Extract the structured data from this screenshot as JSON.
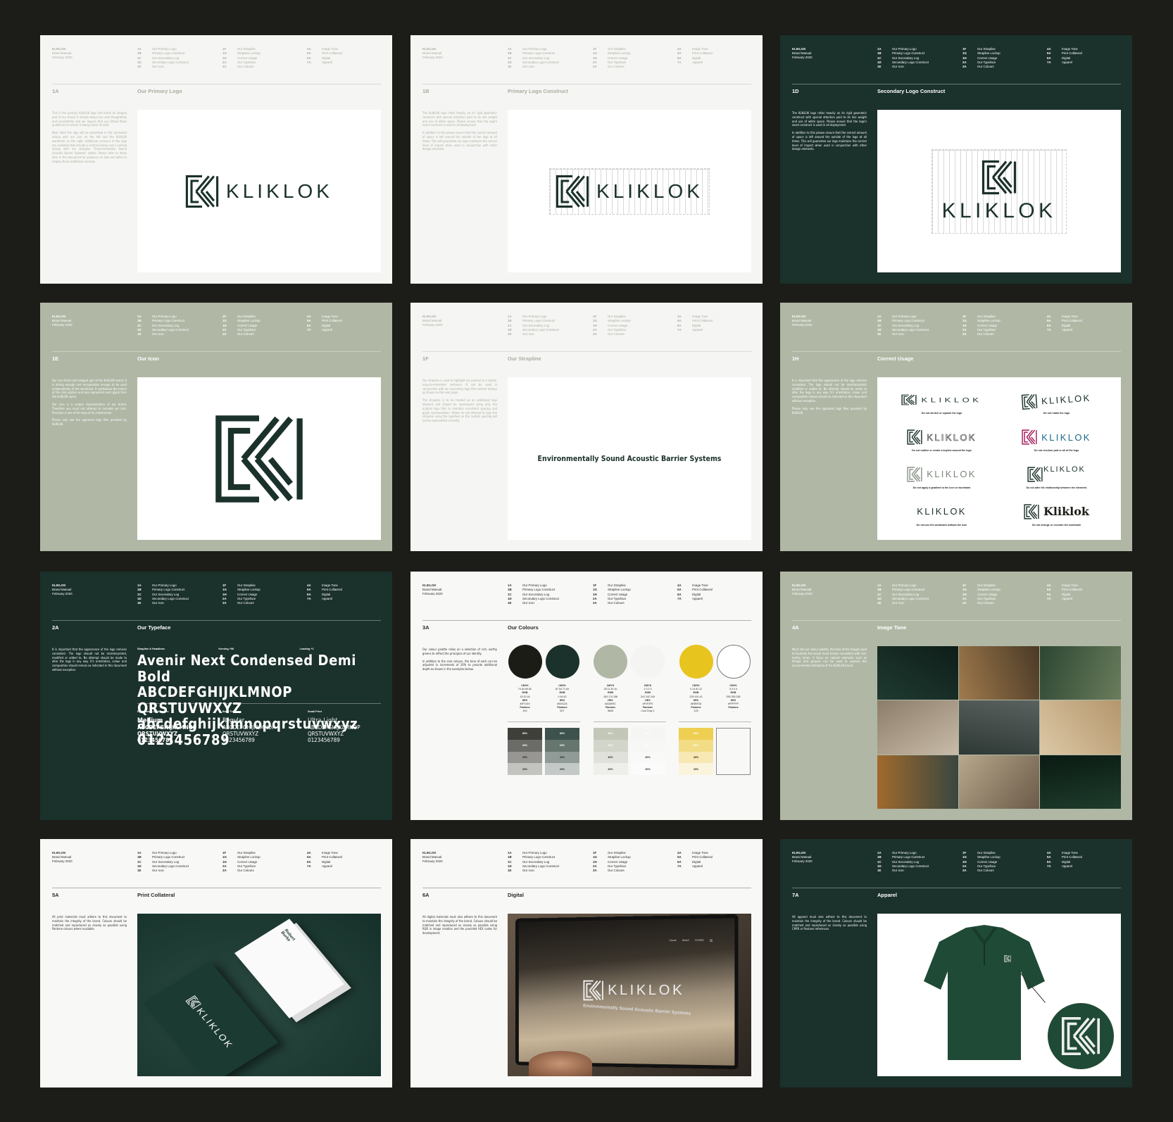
{
  "brand_block": {
    "name": "KLIKLOK",
    "line1": "Brand Manual",
    "line2": "February 2020"
  },
  "nav": [
    [
      [
        "1A",
        "Our Primary Logo"
      ],
      [
        "1B",
        "Primary Logo Construct"
      ],
      [
        "1C",
        "Our Secondary Log"
      ],
      [
        "1D",
        "Secondary Logo Construct"
      ],
      [
        "1E",
        "Our Icon"
      ]
    ],
    [
      [
        "1F",
        "Our Strapline"
      ],
      [
        "1G",
        "Strapline Lockup"
      ],
      [
        "1H",
        "Correct Usage"
      ],
      [
        "2A",
        "Our Typeface"
      ],
      [
        "3A",
        "Our Colours"
      ]
    ],
    [
      [
        "4A",
        "Image Tone"
      ],
      [
        "5A",
        "Print Collateral"
      ],
      [
        "6A",
        "Digital"
      ],
      [
        "7A",
        "Apparel"
      ]
    ]
  ],
  "colors": {
    "dark_green": "#1b312b",
    "sage": "#b0b8a5",
    "off_white": "#f5f5f3",
    "background": "#1c1d18"
  },
  "logo": {
    "wordmark": "KLIKLOK",
    "strapline": "Environmentally Sound Acoustic Barrier Systems"
  },
  "pages": [
    {
      "id": "1A",
      "title": "Our Primary Logo",
      "theme": "light",
      "content": "primary-logo",
      "body": [
        "This is the primary KLIKLOK logo and forms an integral part of our brand. It should always be used thoughtfully and consistently and we require that you follow these guidelines to ensure it always looks its best.",
        "Most often the logo will be presented in this horizontal lockup with our icon on the left and the KLIKLOK wordmark on the right. Additional versions of the logo are available that include a vertical lockup and a vertical lockup with our strapline \"Environmentally Sound Acoustic Barrier Systems\" added. Please refer to items later in this document for guidance on how and when to employ these additional versions."
      ]
    },
    {
      "id": "1B",
      "title": "Primary Logo Construct",
      "theme": "light",
      "content": "logo-construct",
      "body": [
        "The KLIKLOK logo relies heavily on its rigid geometric construct with special attention paid to its line weight and use of white space. Please ensure that the logo's exact construct is used in all deployment.",
        "In addition to this please ensure that the correct amount of space is left around the outside of the logo at all times. This will guarantee our logo maintains the correct level of impact when used in conjunction with other design elements."
      ]
    },
    {
      "id": "1D",
      "title": "Secondary Logo Construct",
      "theme": "dark",
      "content": "secondary-construct",
      "body": [
        "The KLIKLOK logo relies heavily on its rigid geometric construct with special attention paid to its line weight and use of white space. Please ensure that the logo's exact construct is used in all deployment.",
        "In addition to this please ensure that the correct amount of space is left around the outside of the logo at all times. This will guarantee our logo maintains the correct level of impact when used in conjunction with other design elements."
      ]
    },
    {
      "id": "1E",
      "title": "Our Icon",
      "theme": "sage",
      "content": "icon",
      "body": [
        "Our icon forms and integral part of the KLIKLOK brand. It is strong enough and recognisable enough to be used independently of the wordmark. It symbolises the nature of the click system and also represents each glyph from the KLIKLOK name.",
        "Our icon is a unique representation of our brand. Therefore you must not attempt to recreate our icon. Precision is one of the keys of its construction.",
        "Please only use the approved logo files provided by KLIKLOK."
      ]
    },
    {
      "id": "1F",
      "title": "Our Strapline",
      "theme": "light",
      "content": "strapline",
      "body": [
        "Our strapline is used to highlight our product in a simple, easy-to-remember sentence. It can be used in conjunction with our secondary logo (the vertical lockup) as shown on the next page.",
        "The strapline is to be treated as an additional logo element and should be reproduced using only the original logo files to maintain consistent spacing and glyph representation. Please do not attempt to type the strapline using the typeface as the custom spacing will not be represented correctly."
      ]
    },
    {
      "id": "1H",
      "title": "Correct Usage",
      "theme": "sage",
      "content": "usage",
      "body": [
        "It is important that the appearance of the logo remains consistent. The logo should not be misinterpreted, modified or added to. No attempt should be made to alter the logo in any way. It's orientation, colour and composition should remain as indicated in this document without exception.",
        "Please only use the approved logo files provided by KLIKLOK."
      ]
    },
    {
      "id": "2A",
      "title": "Our Typeface",
      "theme": "dark",
      "content": "typeface",
      "body": [
        "It is important that the appearance of the logo remains consistent. The logo should not be misinterpreted, modified or added to. No attempt should be made to alter the logo in any way. It's orientation, colour and composition should remain as indicated in this document without exception."
      ]
    },
    {
      "id": "3A",
      "title": "Our Colours",
      "theme": "white",
      "content": "colours",
      "body": [
        "Our colour palette relies on a selection of rich, earthy greens to reflect the principles of our identity.",
        "In addition to the core colours, the tone of each can be adjusted in increments of 20% to provide additional depth as shown in the examples below."
      ]
    },
    {
      "id": "4A",
      "title": "Image Tone",
      "theme": "sage",
      "content": "image-tone",
      "body": [
        "Much like our colour palette, the tone of the images used to illustrate the brand must remain consistent with rich, earthy tones. A focus on natural elements such as foliage and grasses can be used to express the environmental attributes of the KLIKLOK brand."
      ]
    },
    {
      "id": "5A",
      "title": "Print Collateral",
      "theme": "white",
      "content": "print",
      "body": [
        "All print materials must adhere to this document to maintain the integrity of the brand. Colours should be matched and reproduced as closely as possible using Pantone colours where available."
      ]
    },
    {
      "id": "6A",
      "title": "Digital",
      "theme": "white",
      "content": "digital",
      "body": [
        "All digital materials must also adhere to this document to maintain the integrity of the brand. Colours should be matched and reproduced as closely as possible using RGB in image creation and the provided HEX codes for development."
      ]
    },
    {
      "id": "7A",
      "title": "Apparel",
      "theme": "dark",
      "content": "apparel",
      "body": [
        "All apparel must also adhere to this document to maintain the integrity of the brand. Colours should be matched and reproduced as closely as possible using CMYK or Pantone references."
      ]
    }
  ],
  "usage": [
    {
      "wordmark": "KLIKLOK",
      "caption": "Do not stretch or squash the logo",
      "variant": "stretch"
    },
    {
      "wordmark": "KLIKLOK",
      "caption": "Do not rotate the logo",
      "variant": "rotate"
    },
    {
      "wordmark": "KLIKLOK",
      "caption": "Do not outline or create a keyline around the logo",
      "variant": "outline"
    },
    {
      "wordmark": "KLIKLOK",
      "caption": "Do not recolour part or all of the logo",
      "variant": "recolour"
    },
    {
      "wordmark": "KLIKLOK",
      "caption": "Do not apply a gradient to the icon or wordmark",
      "variant": "gradient"
    },
    {
      "wordmark": "KLIKLOK",
      "caption": "Do not alter the relationship between the elements",
      "variant": "relationship"
    },
    {
      "wordmark": "KLIKLOK",
      "caption": "Do not use the wordmark without the icon",
      "variant": "noicon"
    },
    {
      "wordmark": "Kliklok",
      "caption": "Do not change or recreate the wordmark",
      "variant": "serif"
    }
  ],
  "typeface": {
    "labels": [
      "Strapline & Headlines",
      "Kerning +50",
      "Leading +1"
    ],
    "name": "Avenir Next Condensed Demi Bold",
    "upper1": "ABCDEFGHIJKLMNOP",
    "upper2": "QRSTUVWXYZ",
    "lower": "abcdefghijklmnopqrstuvwxyz",
    "digits": "0123456789",
    "weights": [
      {
        "label": "Eyebrows & Subheaders",
        "weight": "Medium",
        "fw": 600
      },
      {
        "label": "Body Text",
        "weight": "Regular",
        "fw": 400
      },
      {
        "label": "Small Print",
        "weight": "Ultra Light",
        "fw": 200
      }
    ]
  },
  "colour_specs": {
    "cmyk_label": "CMYK",
    "rgb_label": "RGB",
    "hex_label": "HEX",
    "pantone_label": "Pantone"
  },
  "swatches": [
    {
      "color": "#1b1c16",
      "cmyk": "74 64 69 82",
      "rgb": "15 20 16",
      "hex": "#0F1410",
      "pantone": "419",
      "tints": [
        "80%",
        "60%",
        "40%",
        "20%"
      ],
      "tint_colors": [
        "#3f3f3a",
        "#6b6b67",
        "#979692",
        "#c3c3c0"
      ]
    },
    {
      "color": "#1b312b",
      "cmyk": "87 54 71 64",
      "rgb": "0 49 42",
      "hex": "#00312A",
      "pantone": "627",
      "tints": [
        "80%",
        "60%",
        "40%",
        "20%"
      ],
      "tint_colors": [
        "#3d524c",
        "#66766f",
        "#909a96",
        "#c3c9c6"
      ]
    },
    {
      "color": "#b0b8a5",
      "cmyk": "25 11 30 10",
      "rgb": "163 174 156",
      "hex": "#A3AE9C",
      "pantone": "5645",
      "tints": [
        "80%",
        "60%",
        "40%",
        "20%"
      ],
      "tint_colors": [
        "#c2c7b8",
        "#d1d5ca",
        "#dfe1da",
        "#eeefeb"
      ]
    },
    {
      "color": "#f4f4f2",
      "cmyk": "1 0 2 3",
      "rgb": "241 242 240",
      "hex": "#F1F2F0",
      "pantone": "Cool Gray 1",
      "tints": [
        "80%",
        "60%",
        "40%",
        "20%"
      ],
      "tint_colors": [
        "#f5f5f4",
        "#f7f7f6",
        "#f9f9f8",
        "#fbfbfb"
      ]
    },
    {
      "color": "#e8c41e",
      "cmyk": "0 14 91 12",
      "rgb": "229 191 42",
      "hex": "#E5BF2A",
      "pantone": "129",
      "tints": [
        "80%",
        "60%",
        "40%",
        "20%"
      ],
      "tint_colors": [
        "#eecf52",
        "#f2dc85",
        "#f7e8b4",
        "#fbf4dd"
      ]
    },
    {
      "color": "#ffffff",
      "cmyk": "0 0 0 0",
      "rgb": "255 255 255",
      "hex": "#FFFFFF",
      "pantone": "-",
      "tints": [],
      "tint_colors": []
    }
  ],
  "image_tiles": [
    [
      "#1f3a30",
      "#0e1e18"
    ],
    [
      "#a07a4c",
      "#4a3a26"
    ],
    [
      "#2c4632",
      "#6a7d5c"
    ],
    [
      "#8c7d6a",
      "#c8bba8"
    ],
    [
      "#5a6260",
      "#2e3834"
    ],
    [
      "#b4966c",
      "#dcc8a6"
    ],
    [
      "#394640",
      "#a06a2c"
    ],
    [
      "#6a5a48",
      "#b8a88c"
    ],
    [
      "#1e3c2c",
      "#0a1a12"
    ]
  ],
  "business_card": {
    "name": "Robert Burke"
  },
  "website_nav": [
    "Home",
    "About",
    "Contact"
  ]
}
